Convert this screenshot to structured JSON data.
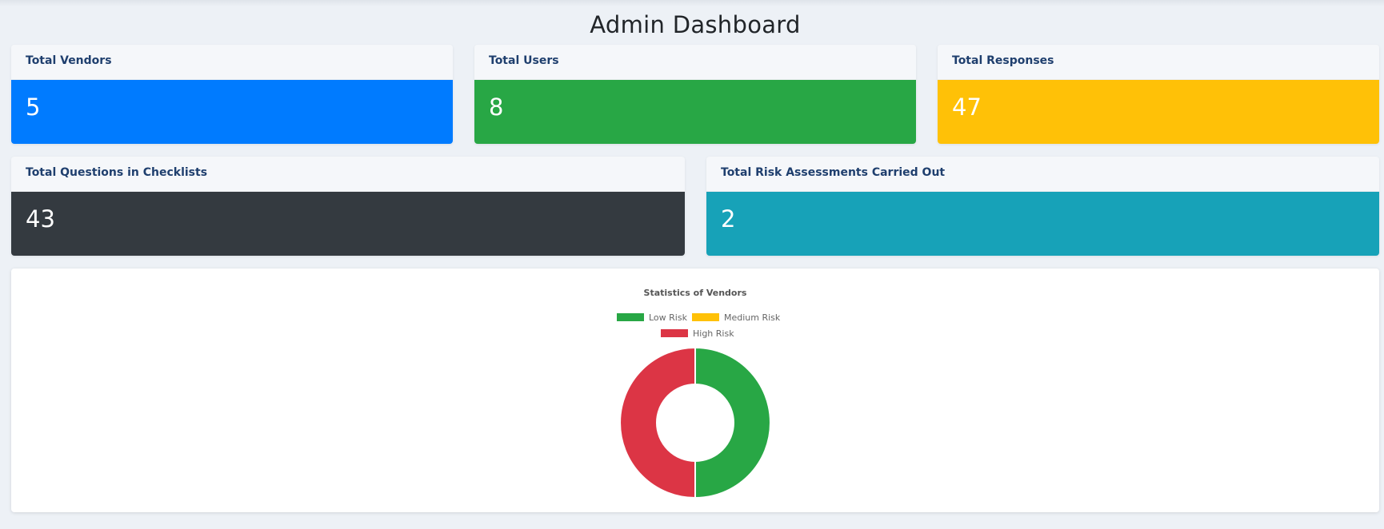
{
  "page": {
    "title": "Admin Dashboard"
  },
  "stats": [
    {
      "label": "Total Vendors",
      "value": "5",
      "color": "#007bff"
    },
    {
      "label": "Total Users",
      "value": "8",
      "color": "#28a745"
    },
    {
      "label": "Total Responses",
      "value": "47",
      "color": "#ffc107"
    },
    {
      "label": "Total Questions in Checklists",
      "value": "43",
      "color": "#343a40"
    },
    {
      "label": "Total Risk Assessments Carried Out",
      "value": "2",
      "color": "#17a2b8"
    }
  ],
  "chart_data": {
    "type": "pie",
    "title": "Statistics of Vendors",
    "categories": [
      "Low Risk",
      "Medium Risk",
      "High Risk"
    ],
    "values": [
      1,
      0,
      1
    ],
    "colors": [
      "#28a745",
      "#ffc107",
      "#dc3545"
    ],
    "legend_position": "top"
  }
}
